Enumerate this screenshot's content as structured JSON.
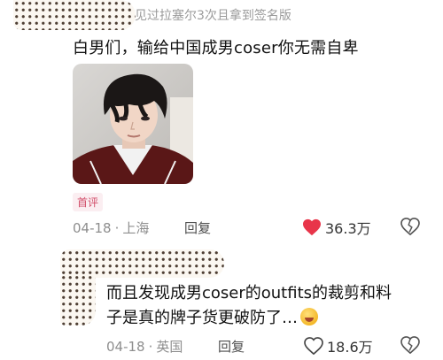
{
  "comments": [
    {
      "username": "见过拉塞尔3次且拿到签名版",
      "text": "白男们，输给中国成男coser你无需自卑",
      "tag": "首评",
      "date": "04-18",
      "location": "上海",
      "reply_label": "回复",
      "likes": "36.3万",
      "liked": true
    },
    {
      "text_lines": [
        "而且发现成男coser的outfits的裁剪和料",
        "子是真的牌子货更破防了…"
      ],
      "date": "04-18",
      "location": "英国",
      "reply_label": "回复",
      "likes": "18.6万",
      "liked": false
    }
  ],
  "icons": {
    "like_filled": "heart-filled-icon",
    "like_outline": "heart-outline-icon",
    "dislike": "broken-heart-icon",
    "emoji": "rofl-emoji-icon"
  },
  "colors": {
    "like_red": "#e8354a",
    "meta_gray": "#8e8e8e",
    "tag_pink": "#d24f6a"
  }
}
